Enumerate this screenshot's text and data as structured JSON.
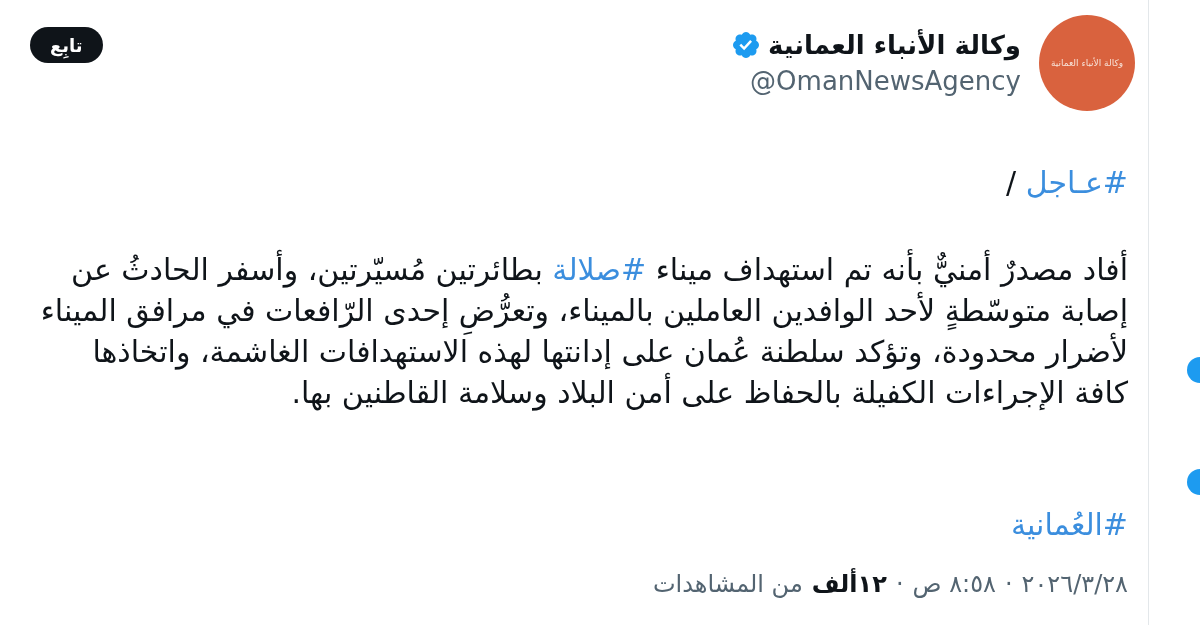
{
  "account": {
    "avatar_text": "وكالة الأنباء العمانية",
    "name": "وكالة الأنباء العمانية",
    "verified": true,
    "handle": "@OmanNewsAgency"
  },
  "follow_button": {
    "label": "تابِع"
  },
  "tweet": {
    "paragraphs": [
      {
        "segments": [
          {
            "kind": "hashtag",
            "text": "#عـاجل"
          },
          {
            "kind": "text",
            "text": " /"
          }
        ]
      },
      {
        "segments": [
          {
            "kind": "text",
            "text": "أفاد مصدرٌ أمنيٌّ بأنه تم استهداف ميناء "
          },
          {
            "kind": "hashtag",
            "text": "#صلالة"
          },
          {
            "kind": "text",
            "text": " بطائرتين مُسيّرتين، وأسفر الحادثُ عن إصابة متوسّطةٍ لأحد الوافدين العاملين بالميناء، وتعرُّضِ إحدى الرّافعات في مرافق الميناء لأضرار محدودة، وتؤكد سلطنة عُمان على إدانتها لهذه الاستهدافات الغاشمة، واتخاذها كافة الإجراءات الكفيلة بالحفاظ على أمن البلاد وسلامة القاطنين بها."
          }
        ]
      },
      {
        "segments": [
          {
            "kind": "hashtag",
            "text": "#العُمانية"
          }
        ]
      }
    ]
  },
  "footer": [
    {
      "kind": "date",
      "text": "٢٨‏/٣‏/٢٠٢٦"
    },
    {
      "kind": "separator",
      "text": "·"
    },
    {
      "kind": "time",
      "text": "٨:٥٨ ص"
    },
    {
      "kind": "separator",
      "text": "·"
    },
    {
      "kind": "count",
      "text": "١٢ألف"
    },
    {
      "kind": "label",
      "text": "من المشاهدات"
    }
  ]
}
